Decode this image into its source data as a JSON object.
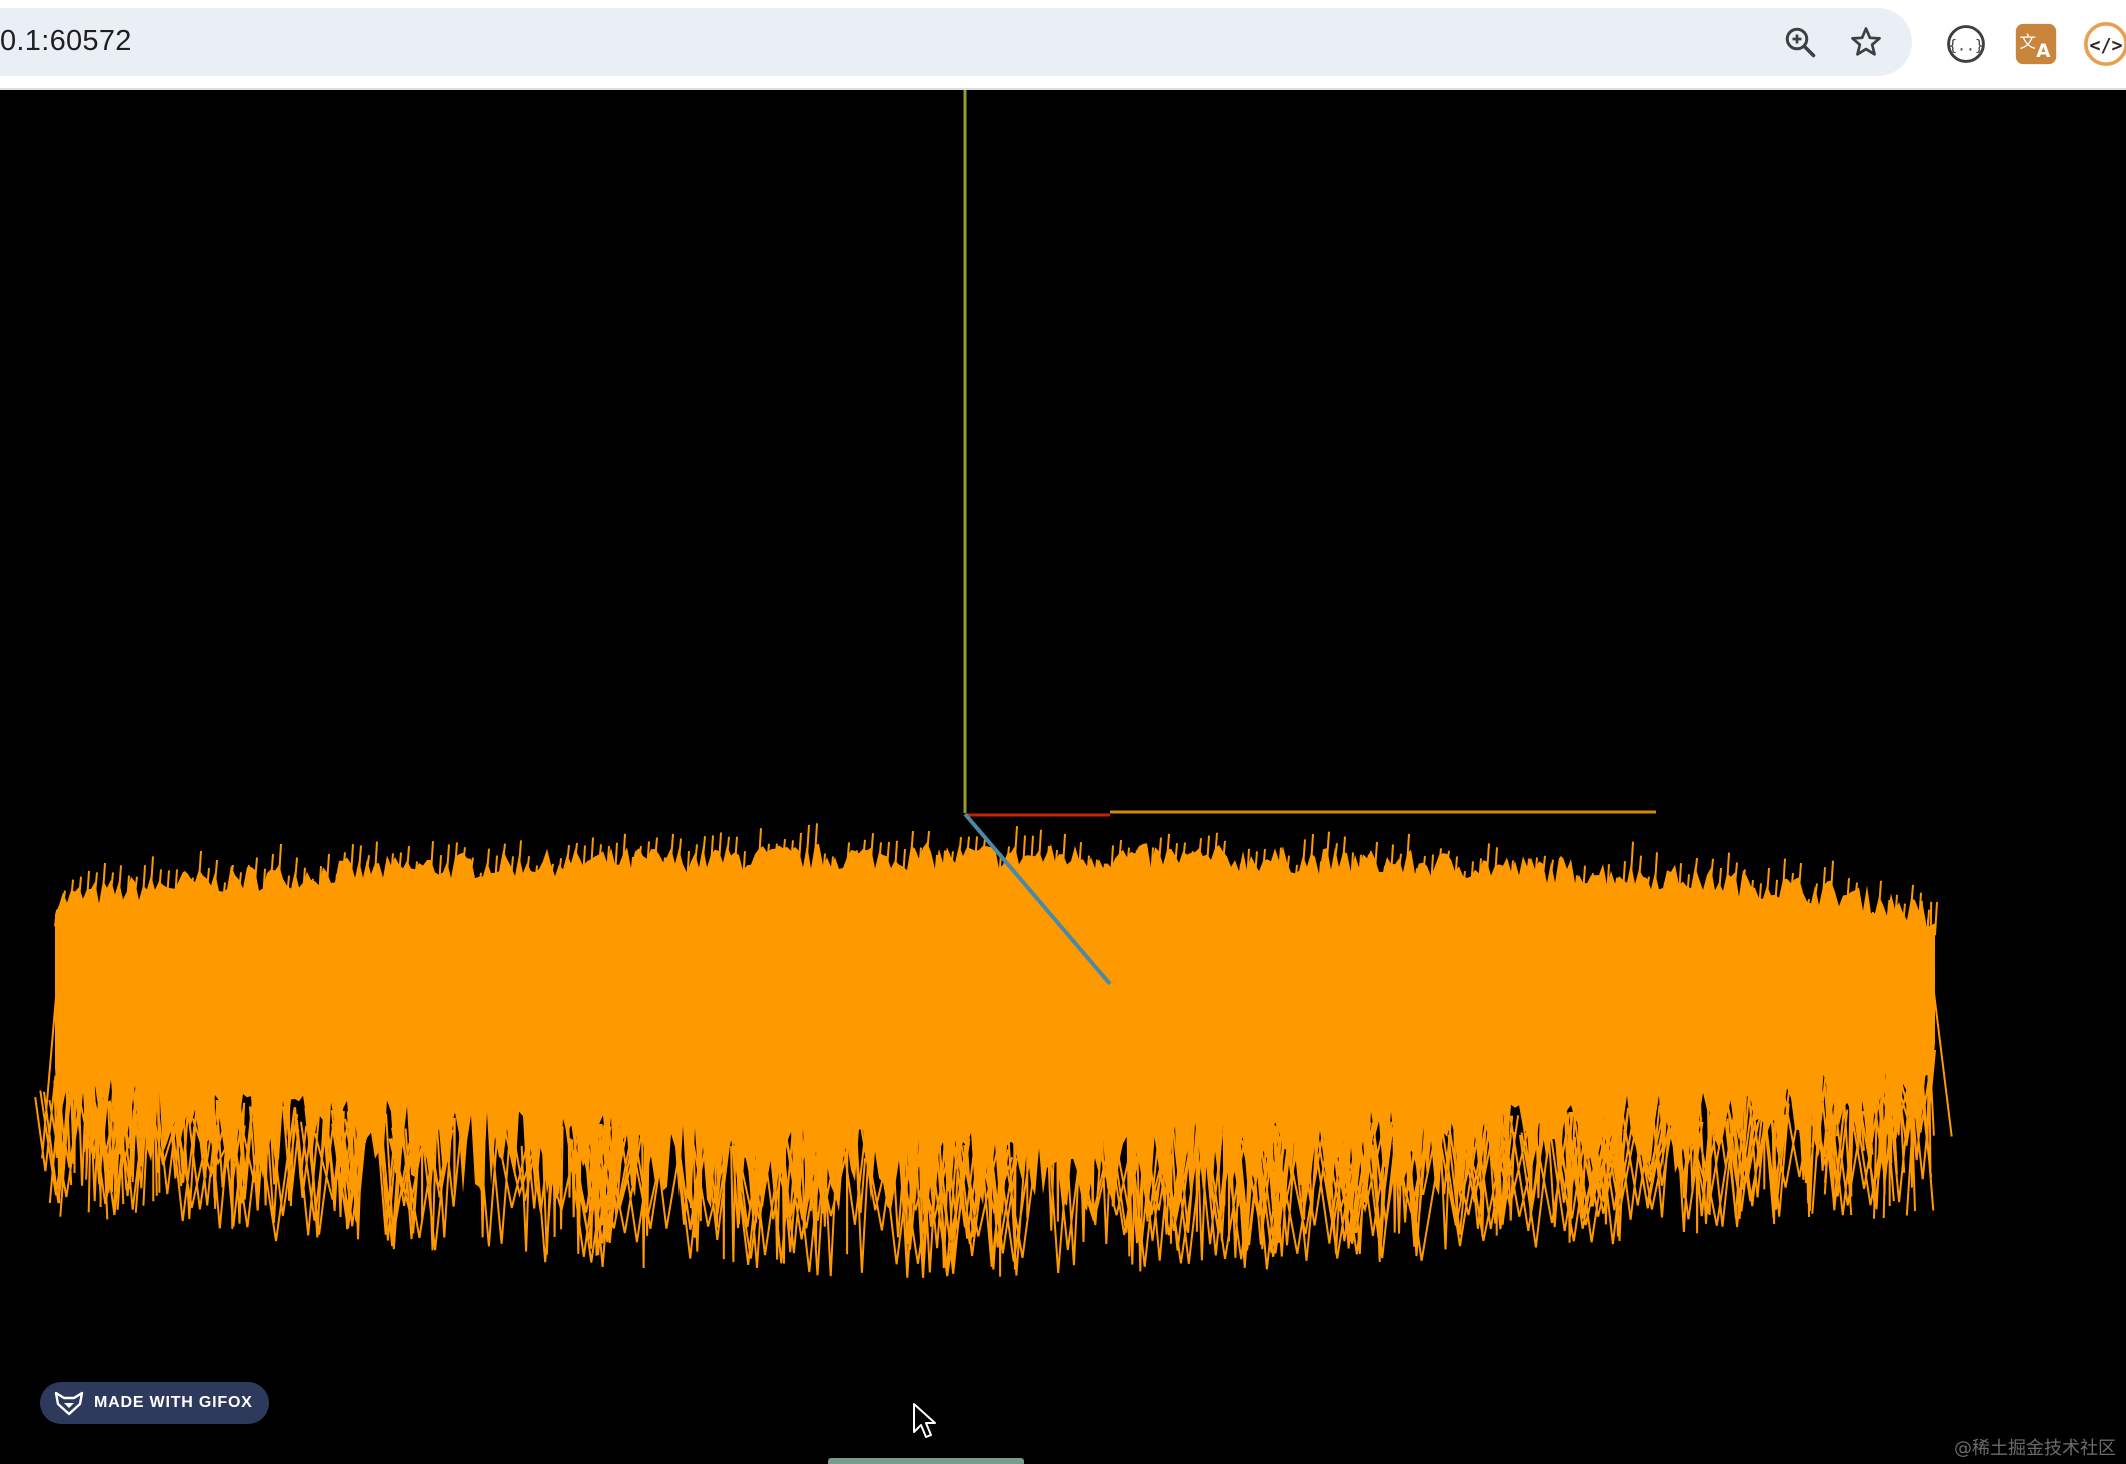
{
  "browser": {
    "url": "0.1:60572",
    "icons": {
      "zoom": "zoom-in-icon",
      "bookmark": "star-icon",
      "json_ext": "json-viewer-icon",
      "translate_ext": "translate-icon",
      "devtools_ext": "code-icon"
    }
  },
  "scene": {
    "background": "#000000",
    "terrain_color": "#ff9900",
    "axis_colors": {
      "x": "#cc2200",
      "y": "#9a9a30",
      "z": "#4a8aa6",
      "x_extension": "#d08a10"
    }
  },
  "overlay": {
    "gifox_label": "MADE WITH GIFOX",
    "watermark": "@稀土掘金技术社区"
  }
}
